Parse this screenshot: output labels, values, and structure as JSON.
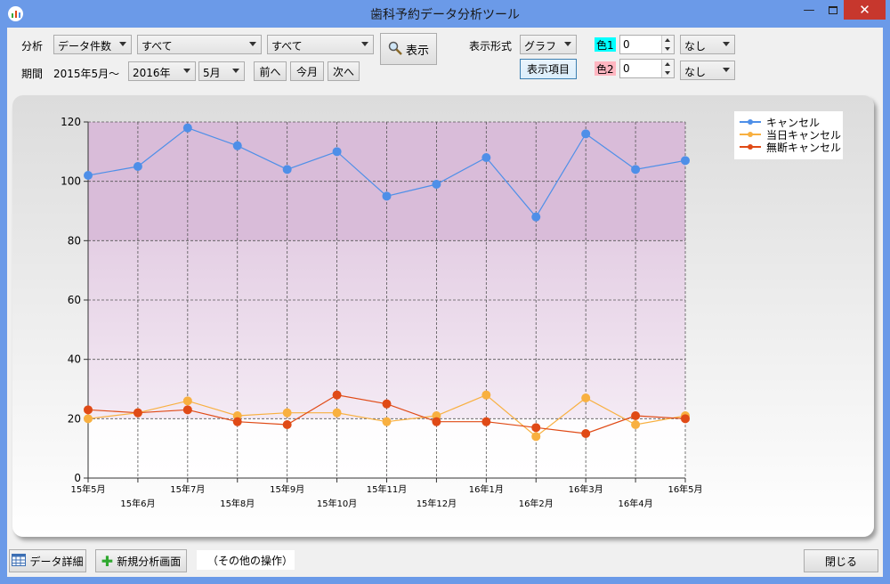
{
  "window": {
    "title": "歯科予約データ分析ツール"
  },
  "toolbar": {
    "analysis_label": "分析",
    "analysis_type": "データ件数",
    "filter1": "すべて",
    "filter2": "すべて",
    "show_button": "表示",
    "period_label": "期間",
    "period_start": "2015年5月～",
    "year_select": "2016年",
    "month_select": "5月",
    "prev_button": "前へ",
    "this_month_button": "今月",
    "next_button": "次へ",
    "display_format_label": "表示形式",
    "display_format": "グラフ",
    "display_items_button": "表示項目",
    "color1_label": "色1",
    "color1_value": "0",
    "color1_mode": "なし",
    "color2_label": "色2",
    "color2_value": "0",
    "color2_mode": "なし",
    "color1_tag_color": "#00ffff",
    "color2_tag_color": "#ffb6c1"
  },
  "chart_data": {
    "type": "line",
    "x": [
      "15年5月",
      "15年6月",
      "15年7月",
      "15年8月",
      "15年9月",
      "15年10月",
      "15年11月",
      "15年12月",
      "16年1月",
      "16年2月",
      "16年3月",
      "16年4月",
      "16年5月"
    ],
    "ylim": [
      0,
      120
    ],
    "yticks": [
      0,
      20,
      40,
      60,
      80,
      100,
      120
    ],
    "grid": true,
    "legend_position": "top-right",
    "series": [
      {
        "name": "キャンセル",
        "color": "#4e8fe8",
        "values": [
          102,
          105,
          118,
          112,
          104,
          110,
          95,
          99,
          108,
          88,
          116,
          104,
          107
        ]
      },
      {
        "name": "当日キャンセル",
        "color": "#f8b040",
        "values": [
          20,
          22,
          26,
          21,
          22,
          22,
          19,
          21,
          28,
          14,
          27,
          18,
          21
        ]
      },
      {
        "name": "無断キャンセル",
        "color": "#e04a16",
        "values": [
          23,
          22,
          23,
          19,
          18,
          28,
          25,
          19,
          19,
          17,
          15,
          21,
          20
        ]
      }
    ],
    "bands": [
      {
        "from": 80,
        "to": 120,
        "color": "#d9bcd9"
      },
      {
        "from": 20,
        "to": 80,
        "gradient": [
          "#e4cfe4",
          "#f4eaf4"
        ]
      }
    ]
  },
  "footer": {
    "data_detail_button": "データ詳細",
    "new_analysis_button": "新規分析画面",
    "other_ops_text": "（その他の操作）",
    "close_button": "閉じる"
  }
}
